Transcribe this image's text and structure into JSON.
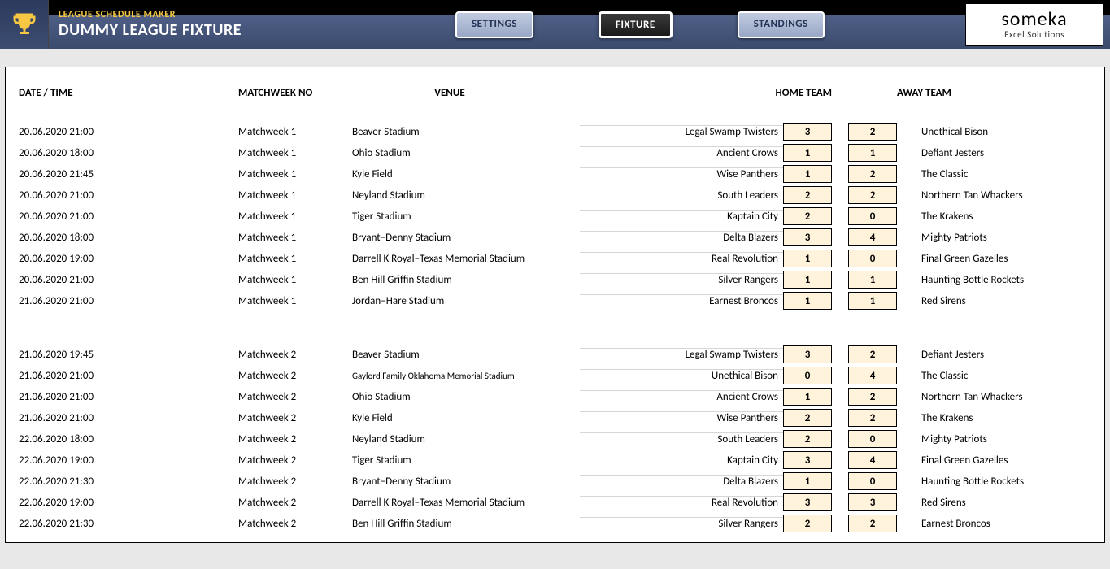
{
  "header": {
    "app_title": "LEAGUE SCHEDULE MAKER",
    "league_title": "DUMMY LEAGUE FIXTURE",
    "nav": {
      "settings": "SETTINGS",
      "fixture": "FIXTURE",
      "standings": "STANDINGS"
    },
    "logo_main": "someka",
    "logo_sub": "Excel Solutions"
  },
  "columns": {
    "datetime": "DATE / TIME",
    "matchweek": "MATCHWEEK NO",
    "venue": "VENUE",
    "home": "HOME TEAM",
    "away": "AWAY TEAM"
  },
  "groups": [
    {
      "rows": [
        {
          "dt": "20.06.2020 21:00",
          "mw": "Matchweek 1",
          "venue": "Beaver Stadium",
          "home": "Legal Swamp Twisters",
          "hs": "3",
          "as": "2",
          "away": "Unethical Bison"
        },
        {
          "dt": "20.06.2020 18:00",
          "mw": "Matchweek 1",
          "venue": "Ohio Stadium",
          "home": "Ancient Crows",
          "hs": "1",
          "as": "1",
          "away": "Defiant Jesters"
        },
        {
          "dt": "20.06.2020 21:45",
          "mw": "Matchweek 1",
          "venue": "Kyle Field",
          "home": "Wise Panthers",
          "hs": "1",
          "as": "2",
          "away": "The Classic"
        },
        {
          "dt": "20.06.2020 21:00",
          "mw": "Matchweek 1",
          "venue": "Neyland Stadium",
          "home": "South Leaders",
          "hs": "2",
          "as": "2",
          "away": "Northern Tan Whackers"
        },
        {
          "dt": "20.06.2020 21:00",
          "mw": "Matchweek 1",
          "venue": "Tiger Stadium",
          "home": "Kaptain City",
          "hs": "2",
          "as": "0",
          "away": "The Krakens"
        },
        {
          "dt": "20.06.2020 18:00",
          "mw": "Matchweek 1",
          "venue": "Bryant–Denny Stadium",
          "home": "Delta Blazers",
          "hs": "3",
          "as": "4",
          "away": "Mighty Patriots"
        },
        {
          "dt": "20.06.2020 19:00",
          "mw": "Matchweek 1",
          "venue": "Darrell K Royal–Texas Memorial Stadium",
          "home": "Real Revolution",
          "hs": "1",
          "as": "0",
          "away": "Final Green Gazelles"
        },
        {
          "dt": "20.06.2020 21:00",
          "mw": "Matchweek 1",
          "venue": "Ben Hill Griffin Stadium",
          "home": "Silver Rangers",
          "hs": "1",
          "as": "1",
          "away": "Haunting Bottle Rockets"
        },
        {
          "dt": "21.06.2020 21:00",
          "mw": "Matchweek 1",
          "venue": "Jordan–Hare Stadium",
          "home": "Earnest Broncos",
          "hs": "1",
          "as": "1",
          "away": "Red Sirens"
        }
      ]
    },
    {
      "rows": [
        {
          "dt": "21.06.2020 19:45",
          "mw": "Matchweek 2",
          "venue": "Beaver Stadium",
          "home": "Legal Swamp Twisters",
          "hs": "3",
          "as": "2",
          "away": "Defiant Jesters"
        },
        {
          "dt": "21.06.2020 21:00",
          "mw": "Matchweek 2",
          "venue": "Gaylord Family Oklahoma Memorial Stadium",
          "venue_small": true,
          "home": "Unethical Bison",
          "hs": "0",
          "as": "4",
          "away": "The Classic"
        },
        {
          "dt": "21.06.2020 21:00",
          "mw": "Matchweek 2",
          "venue": "Ohio Stadium",
          "home": "Ancient Crows",
          "hs": "1",
          "as": "2",
          "away": "Northern Tan Whackers"
        },
        {
          "dt": "21.06.2020 21:00",
          "mw": "Matchweek 2",
          "venue": "Kyle Field",
          "home": "Wise Panthers",
          "hs": "2",
          "as": "2",
          "away": "The Krakens"
        },
        {
          "dt": "22.06.2020 18:00",
          "mw": "Matchweek 2",
          "venue": "Neyland Stadium",
          "home": "South Leaders",
          "hs": "2",
          "as": "0",
          "away": "Mighty Patriots"
        },
        {
          "dt": "22.06.2020 19:00",
          "mw": "Matchweek 2",
          "venue": "Tiger Stadium",
          "home": "Kaptain City",
          "hs": "3",
          "as": "4",
          "away": "Final Green Gazelles"
        },
        {
          "dt": "22.06.2020 21:30",
          "mw": "Matchweek 2",
          "venue": "Bryant–Denny Stadium",
          "home": "Delta Blazers",
          "hs": "1",
          "as": "0",
          "away": "Haunting Bottle Rockets"
        },
        {
          "dt": "22.06.2020 19:00",
          "mw": "Matchweek 2",
          "venue": "Darrell K Royal–Texas Memorial Stadium",
          "home": "Real Revolution",
          "hs": "3",
          "as": "3",
          "away": "Red Sirens"
        },
        {
          "dt": "22.06.2020 21:30",
          "mw": "Matchweek 2",
          "venue": "Ben Hill Griffin Stadium",
          "home": "Silver Rangers",
          "hs": "2",
          "as": "2",
          "away": "Earnest Broncos"
        }
      ]
    }
  ]
}
